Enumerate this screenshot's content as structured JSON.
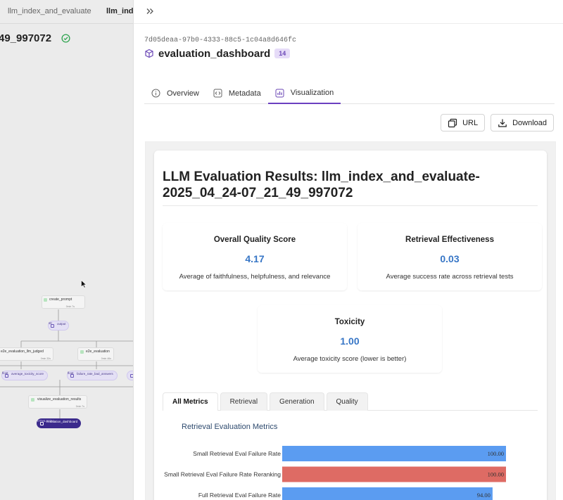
{
  "left_panel": {
    "tabs": [
      "llm_index_and_evaluate",
      "llm_inde"
    ],
    "run_title": "49_997072",
    "dag": {
      "steps": [
        {
          "name": "create_prompt",
          "duration": "0min 7s"
        },
        {
          "name": "e2e_evaluation_llm_judged",
          "duration": "0min 32s"
        },
        {
          "name": "e2e_evaluation",
          "duration": "0min 46s"
        },
        {
          "name": "visualize_evaluation_results",
          "duration": "0min 7s"
        }
      ],
      "artifacts": [
        {
          "name": "output",
          "type": "str"
        },
        {
          "name": "average_toxicity_score",
          "type": "float"
        },
        {
          "name": "failure_rate_bad_answers",
          "type": "float"
        },
        {
          "name": "evaluation_dashboard",
          "type": "HTMLString"
        }
      ]
    }
  },
  "header": {
    "uuid": "7d05deaa-97b0-4333-88c5-1c04a8d646fc",
    "artifact_name": "evaluation_dashboard",
    "version": "14"
  },
  "tabs": [
    {
      "label": "Overview",
      "icon": "info-icon"
    },
    {
      "label": "Metadata",
      "icon": "code-icon"
    },
    {
      "label": "Visualization",
      "icon": "chart-icon"
    }
  ],
  "actions": {
    "url_label": "URL",
    "download_label": "Download"
  },
  "report": {
    "title": "LLM Evaluation Results: llm_index_and_evaluate-2025_04_24-07_21_49_997072",
    "metrics": [
      {
        "label": "Overall Quality Score",
        "value": "4.17",
        "desc": "Average of faithfulness, helpfulness, and relevance"
      },
      {
        "label": "Retrieval Effectiveness",
        "value": "0.03",
        "desc": "Average success rate across retrieval tests"
      },
      {
        "label": "Toxicity",
        "value": "1.00",
        "desc": "Average toxicity score (lower is better)"
      }
    ],
    "sub_tabs": [
      "All Metrics",
      "Retrieval",
      "Generation",
      "Quality"
    ]
  },
  "chart_data": {
    "type": "bar",
    "orientation": "horizontal",
    "title": "Retrieval Evaluation Metrics",
    "categories": [
      "Small Retrieval Eval Failure Rate",
      "Small Retrieval Eval Failure Rate Reranking",
      "Full Retrieval Eval Failure Rate"
    ],
    "values": [
      100.0,
      100.0,
      94.0
    ],
    "data_labels": [
      "100.00",
      "100.00",
      "94.00"
    ],
    "colors": [
      "#5b9cf1",
      "#de6b64",
      "#5b9cf1"
    ],
    "xlim": [
      0,
      100
    ]
  }
}
